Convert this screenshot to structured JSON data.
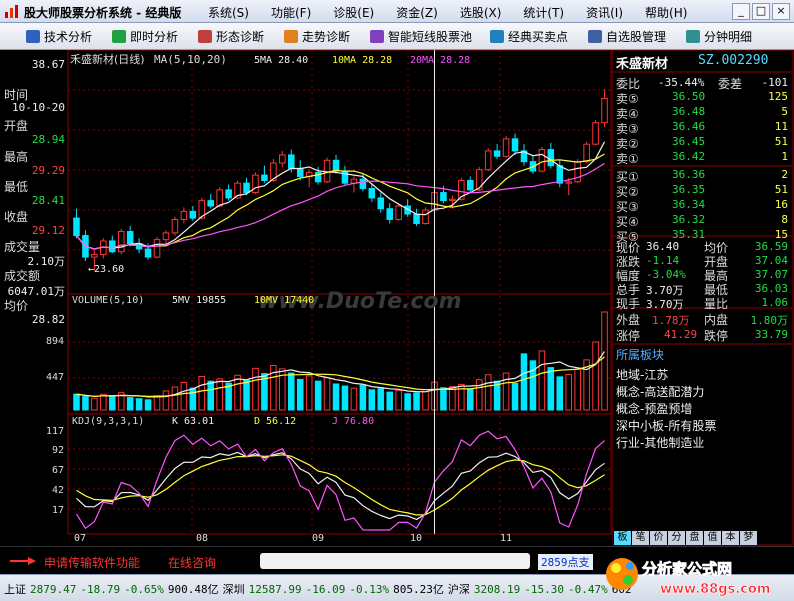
{
  "app": {
    "title": "股大师股票分析系统 - 经典版",
    "menu": [
      "系统(S)",
      "功能(F)",
      "诊股(E)",
      "资金(Z)",
      "选股(X)",
      "统计(T)",
      "资讯(I)",
      "帮助(H)"
    ],
    "window_buttons": [
      "_",
      "□",
      "×"
    ]
  },
  "toolbar": [
    "技术分析",
    "即时分析",
    "形态诊断",
    "走势诊断",
    "智能短线股票池",
    "经典买卖点",
    "自选股管理",
    "分钟明细"
  ],
  "chart_info": {
    "stock": "禾盛新材(日线)",
    "ma_label": "MA(5,10,20)",
    "ma5": "5MA 28.40",
    "ma10": "10MA 28.28",
    "ma20": "20MA 28.28",
    "low_annotation": "←23.60",
    "price_top": "38.67",
    "volume_label": "VOLUME(5,10)",
    "vol5": "5MV 19855",
    "vol10": "10MV 17440",
    "vol_ticks": [
      "894",
      "447"
    ],
    "kdj_label": "KDJ(9,3,3,1)",
    "k": "K 63.01",
    "d": "D 56.12",
    "j": "J 76.80",
    "kdj_ticks": [
      "117",
      "92",
      "67",
      "42",
      "17"
    ],
    "months": [
      "07",
      "08",
      "09",
      "10",
      "11"
    ],
    "watermark": "www.DuoTe.com"
  },
  "left_panel": {
    "time_label": "时间",
    "time_value": "10-10-20",
    "open_label": "开盘",
    "open_value": "28.94",
    "high_label": "最高",
    "high_value": "29.29",
    "low_label": "最低",
    "low_value": "28.41",
    "close_label": "收盘",
    "close_value": "29.12",
    "volume_label": "成交量",
    "volume_value": "2.10万",
    "amount_label": "成交额",
    "amount_value": "6047.01万",
    "avg_label": "均价",
    "avg_value": "28.82"
  },
  "right_panel": {
    "name": "禾盛新材",
    "code": "SZ.002290",
    "weibi_label": "委比",
    "weibi_value": "-35.44%",
    "weicha_label": "委差",
    "weicha_value": "-101",
    "sells": [
      {
        "label": "卖⑤",
        "price": "36.50",
        "vol": "125"
      },
      {
        "label": "卖④",
        "price": "36.48",
        "vol": "5"
      },
      {
        "label": "卖③",
        "price": "36.46",
        "vol": "11"
      },
      {
        "label": "卖②",
        "price": "36.45",
        "vol": "51"
      },
      {
        "label": "卖①",
        "price": "36.42",
        "vol": "1"
      }
    ],
    "buys": [
      {
        "label": "买①",
        "price": "36.36",
        "vol": "2"
      },
      {
        "label": "买②",
        "price": "36.35",
        "vol": "51"
      },
      {
        "label": "买③",
        "price": "36.34",
        "vol": "16"
      },
      {
        "label": "买④",
        "price": "36.32",
        "vol": "8"
      },
      {
        "label": "买⑤",
        "price": "35.31",
        "vol": "15"
      }
    ],
    "quote": [
      {
        "l1": "现价",
        "v1": "36.40",
        "l2": "均价",
        "v2": "36.59"
      },
      {
        "l1": "涨跌",
        "v1": "-1.14",
        "l2": "开盘",
        "v2": "37.04"
      },
      {
        "l1": "幅度",
        "v1": "-3.04%",
        "l2": "最高",
        "v2": "37.07"
      },
      {
        "l1": "总手",
        "v1": "3.70万",
        "l2": "最低",
        "v2": "36.03"
      },
      {
        "l1": "现手",
        "v1": "3.70万",
        "l2": "量比",
        "v2": "1.06"
      }
    ],
    "outer_label": "外盘",
    "outer_value": "1.78万",
    "inner_label": "内盘",
    "inner_value": "1.80万",
    "limit_up_label": "涨停",
    "limit_up_value": "41.29",
    "limit_down_label": "跌停",
    "limit_down_value": "33.79",
    "sector_title": "所属板块",
    "sectors": [
      "地域-江苏",
      "概念-高送配潜力",
      "概念-预盈预增",
      "深中小板-所有股票",
      "行业-其他制造业"
    ],
    "tabs": [
      "板",
      "笔",
      "价",
      "分",
      "盘",
      "值",
      "本",
      "梦"
    ]
  },
  "bottom": {
    "apply_text": "申请传输软件功能",
    "online_text": "在线咨询",
    "count_text": "2859点支",
    "ticker": [
      {
        "name": "上证",
        "price": "2879.47",
        "chg": "-18.79",
        "pct": "-0.65%",
        "amt": "900.48亿"
      },
      {
        "name": "深圳",
        "price": "12587.99",
        "chg": "-16.09",
        "pct": "-0.13%",
        "amt": "805.23亿"
      },
      {
        "name": "沪深",
        "price": "3208.19",
        "chg": "-15.30",
        "pct": "-0.47%",
        "amt": "602"
      }
    ],
    "logo_text": "分析家公式网",
    "logo_url": "www.88gs.com"
  },
  "colors": {
    "up": "#ff3333",
    "down": "#00e5ff",
    "ma5": "#f0f0f0",
    "ma10": "#ffff33",
    "ma20": "#ff55ff",
    "grid": "#8b0000"
  },
  "chart_data": {
    "type": "candlestick",
    "title": "禾盛新材(日线)",
    "ylim": [
      22,
      38.67
    ],
    "x_months": [
      "07",
      "08",
      "09",
      "10",
      "11"
    ],
    "ohlc": [
      [
        27.5,
        28.2,
        26.0,
        26.2
      ],
      [
        26.2,
        26.6,
        24.3,
        24.6
      ],
      [
        24.6,
        25.1,
        23.6,
        24.8
      ],
      [
        24.8,
        26.0,
        24.5,
        25.8
      ],
      [
        25.8,
        26.2,
        24.9,
        25.0
      ],
      [
        25.0,
        26.7,
        24.8,
        26.5
      ],
      [
        26.5,
        26.9,
        25.4,
        25.6
      ],
      [
        25.6,
        26.0,
        24.9,
        25.2
      ],
      [
        25.2,
        25.6,
        24.4,
        24.6
      ],
      [
        24.6,
        26.1,
        24.5,
        25.9
      ],
      [
        25.9,
        26.6,
        25.5,
        26.4
      ],
      [
        26.4,
        27.6,
        26.2,
        27.4
      ],
      [
        27.4,
        28.3,
        27.1,
        28.0
      ],
      [
        28.0,
        28.4,
        27.3,
        27.5
      ],
      [
        27.5,
        29.0,
        27.4,
        28.8
      ],
      [
        28.8,
        29.3,
        28.2,
        28.4
      ],
      [
        28.4,
        29.8,
        28.3,
        29.6
      ],
      [
        29.6,
        30.0,
        28.8,
        29.0
      ],
      [
        29.0,
        30.3,
        28.9,
        30.1
      ],
      [
        30.1,
        30.5,
        29.2,
        29.4
      ],
      [
        29.4,
        30.9,
        29.3,
        30.7
      ],
      [
        30.7,
        31.4,
        30.1,
        30.3
      ],
      [
        30.3,
        31.9,
        30.2,
        31.6
      ],
      [
        31.6,
        32.5,
        31.3,
        32.2
      ],
      [
        32.2,
        32.6,
        30.9,
        31.2
      ],
      [
        31.2,
        31.8,
        30.3,
        30.6
      ],
      [
        30.6,
        31.1,
        29.8,
        30.9
      ],
      [
        30.9,
        31.3,
        30.0,
        30.2
      ],
      [
        30.2,
        32.0,
        30.1,
        31.8
      ],
      [
        31.8,
        32.2,
        30.8,
        31.0
      ],
      [
        31.0,
        31.4,
        29.9,
        30.1
      ],
      [
        30.1,
        30.6,
        29.4,
        30.4
      ],
      [
        30.4,
        30.8,
        29.5,
        29.7
      ],
      [
        29.7,
        30.1,
        28.7,
        29.0
      ],
      [
        29.0,
        29.4,
        27.9,
        28.2
      ],
      [
        28.2,
        28.6,
        27.1,
        27.4
      ],
      [
        27.4,
        28.6,
        27.3,
        28.4
      ],
      [
        28.4,
        28.9,
        27.6,
        27.8
      ],
      [
        27.8,
        28.2,
        26.9,
        27.1
      ],
      [
        27.1,
        28.3,
        27.0,
        28.1
      ],
      [
        28.1,
        29.6,
        28.0,
        29.4
      ],
      [
        29.4,
        29.9,
        28.6,
        28.8
      ],
      [
        28.8,
        29.2,
        28.2,
        28.9
      ],
      [
        28.9,
        30.5,
        28.8,
        30.3
      ],
      [
        30.3,
        30.6,
        29.4,
        29.6
      ],
      [
        29.6,
        31.3,
        29.5,
        31.1
      ],
      [
        31.1,
        32.7,
        31.0,
        32.5
      ],
      [
        32.5,
        33.0,
        31.9,
        32.1
      ],
      [
        32.1,
        33.6,
        32.0,
        33.4
      ],
      [
        33.4,
        33.8,
        32.2,
        32.5
      ],
      [
        32.5,
        33.0,
        31.4,
        31.7
      ],
      [
        31.7,
        32.2,
        30.8,
        31.0
      ],
      [
        31.0,
        32.8,
        30.9,
        32.6
      ],
      [
        32.6,
        33.1,
        31.2,
        31.4
      ],
      [
        31.4,
        31.8,
        29.8,
        30.1
      ],
      [
        30.1,
        30.5,
        29.2,
        30.2
      ],
      [
        30.2,
        31.9,
        30.1,
        31.7
      ],
      [
        31.7,
        33.2,
        31.6,
        33.0
      ],
      [
        33.0,
        34.8,
        32.9,
        34.6
      ],
      [
        34.6,
        37.1,
        34.3,
        36.4
      ]
    ],
    "volume": [
      168,
      142,
      125,
      166,
      152,
      184,
      132,
      120,
      108,
      152,
      202,
      244,
      292,
      232,
      356,
      306,
      330,
      284,
      368,
      316,
      442,
      386,
      472,
      436,
      392,
      324,
      362,
      306,
      342,
      276,
      254,
      232,
      264,
      214,
      226,
      190,
      206,
      172,
      182,
      218,
      296,
      236,
      248,
      272,
      224,
      322,
      374,
      306,
      392,
      282,
      596,
      522,
      626,
      450,
      352,
      376,
      432,
      532,
      722,
      1040
    ],
    "vol_ylim": [
      0,
      1040
    ],
    "kdj_ylim": [
      0,
      117
    ]
  }
}
